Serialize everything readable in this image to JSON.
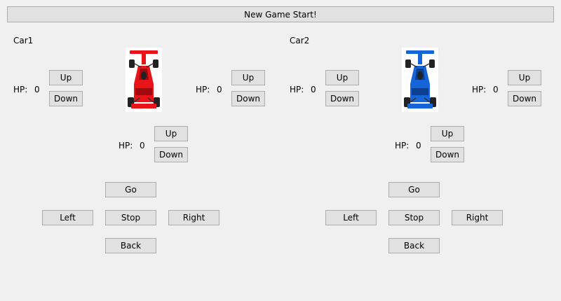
{
  "header": {
    "new_game_label": "New Game Start!"
  },
  "panels": [
    {
      "title": "Car1",
      "car_color": "#e8141a",
      "car_accent": "#a00a0e",
      "stats": [
        {
          "label": "HP:",
          "value": "0",
          "up": "Up",
          "down": "Down"
        },
        {
          "label": "HP:",
          "value": "0",
          "up": "Up",
          "down": "Down"
        },
        {
          "label": "HP:",
          "value": "0",
          "up": "Up",
          "down": "Down"
        }
      ],
      "controls": {
        "go": "Go",
        "left": "Left",
        "stop": "Stop",
        "right": "Right",
        "back": "Back"
      }
    },
    {
      "title": "Car2",
      "car_color": "#1565d8",
      "car_accent": "#0b3f8f",
      "stats": [
        {
          "label": "HP:",
          "value": "0",
          "up": "Up",
          "down": "Down"
        },
        {
          "label": "HP:",
          "value": "0",
          "up": "Up",
          "down": "Down"
        },
        {
          "label": "HP:",
          "value": "0",
          "up": "Up",
          "down": "Down"
        }
      ],
      "controls": {
        "go": "Go",
        "left": "Left",
        "stop": "Stop",
        "right": "Right",
        "back": "Back"
      }
    }
  ],
  "icons": {
    "car": "race-car-icon"
  }
}
